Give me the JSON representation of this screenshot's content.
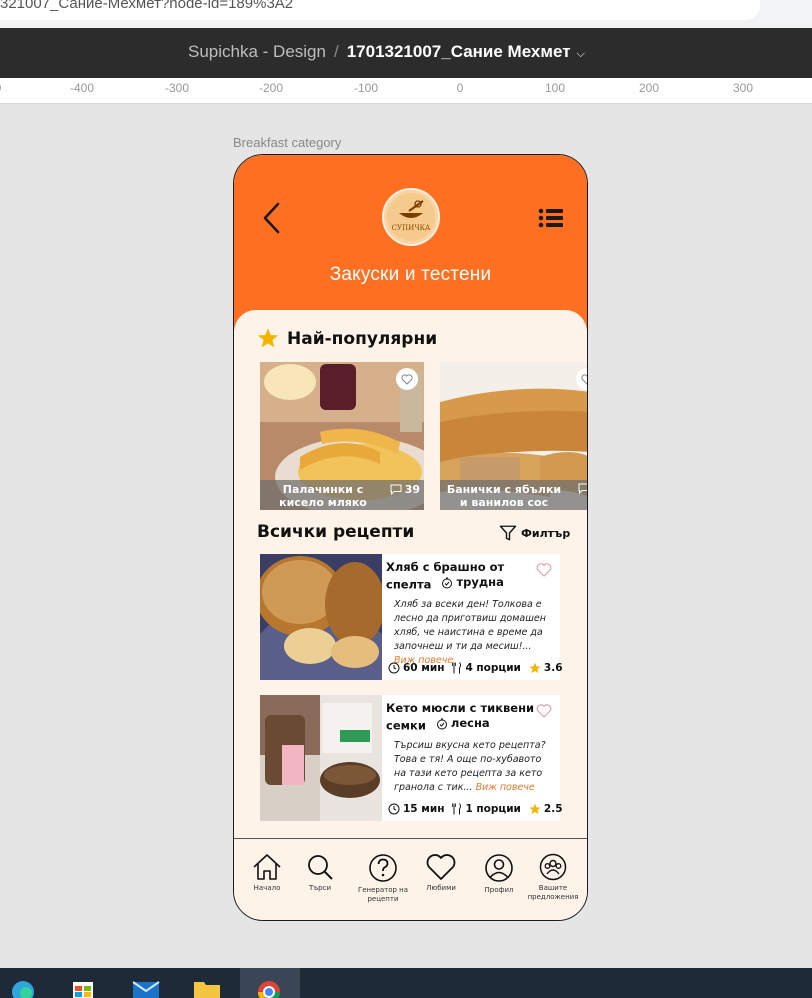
{
  "browser": {
    "url_text": "321007_Сание-Мехмет?node-id=189%3A2"
  },
  "figma": {
    "project": "Supichka - Design",
    "separator": "/",
    "file_name": "1701321007_Сание Мехмет",
    "ruler_ticks": [
      "0",
      "-400",
      "-300",
      "-200",
      "-100",
      "0",
      "100",
      "200",
      "300"
    ],
    "frame_label": "Breakfast category"
  },
  "app": {
    "logo_text": "СУПИЧКА",
    "page_title": "Закуски и тестени",
    "popular": {
      "title": "Най-популярни",
      "items": [
        {
          "caption": "Палачинки с кисело мляко",
          "comments": "39"
        },
        {
          "caption": "Банички с ябълки и ванилов сос",
          "comments": ""
        }
      ]
    },
    "all_recipes": {
      "title": "Всички рецепти",
      "filter_label": "Филтър",
      "items": [
        {
          "name": "Хляб с брашно от спелта",
          "difficulty": "трудна",
          "description": "Хляб за всеки ден! Толкова е лесно да приготвиш домашен хляб, че наистина е време да започнеш и ти да месиш!...",
          "more": "Виж повече",
          "time": "60 мин",
          "portions": "4 порции",
          "rating": "3.6"
        },
        {
          "name": "Кето мюсли с тиквени семки",
          "difficulty": "лесна",
          "description": "Търсиш вкусна кето рецепта? Това е тя! А още по-хубавото на тази кето рецепта за кето гранола с тик...",
          "more": "Виж повече",
          "time": "15 мин",
          "portions": "1 порции",
          "rating": "2.5"
        }
      ]
    },
    "nav": [
      {
        "label": "Начало",
        "icon": "home-icon"
      },
      {
        "label": "Търси",
        "icon": "search-icon"
      },
      {
        "label": "Генератор на рецепти",
        "icon": "question-icon"
      },
      {
        "label": "Любими",
        "icon": "heart-icon"
      },
      {
        "label": "Профил",
        "icon": "user-icon"
      },
      {
        "label": "Вашите предложения",
        "icon": "community-icon"
      }
    ]
  },
  "colors": {
    "accent": "#ff6f21",
    "background": "#fdf3e8",
    "star": "#f5b400",
    "link": "#e87a2b"
  }
}
